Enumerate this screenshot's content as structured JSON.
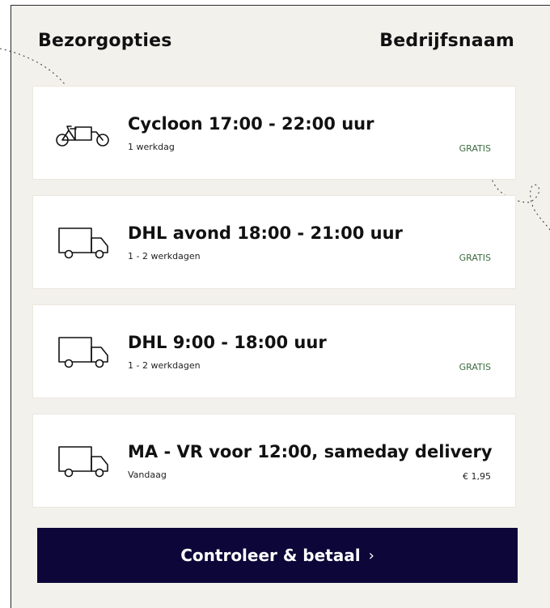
{
  "header": {
    "title": "Bezorgopties",
    "company": "Bedrijfsnaam"
  },
  "options": [
    {
      "icon": "bicycle-icon",
      "name": "Cycloon 17:00 - 22:00 uur",
      "sub": "1 werkdag",
      "price": "GRATIS"
    },
    {
      "icon": "truck-icon",
      "name": "DHL avond 18:00 - 21:00 uur",
      "sub": "1 - 2 werkdagen",
      "price": "GRATIS"
    },
    {
      "icon": "truck-icon",
      "name": "DHL 9:00 - 18:00 uur",
      "sub": "1 - 2 werkdagen",
      "price": "GRATIS"
    },
    {
      "icon": "truck-icon",
      "name": "MA - VR voor 12:00, sameday delivery",
      "sub": "Vandaag",
      "price": "€ 1,95"
    }
  ],
  "cta": {
    "label": "Controleer & betaal",
    "chevron": "›"
  },
  "colors": {
    "panel_bg": "#f3f1ec",
    "cta_bg": "#0c0639",
    "free_green": "#3b6b3f"
  }
}
